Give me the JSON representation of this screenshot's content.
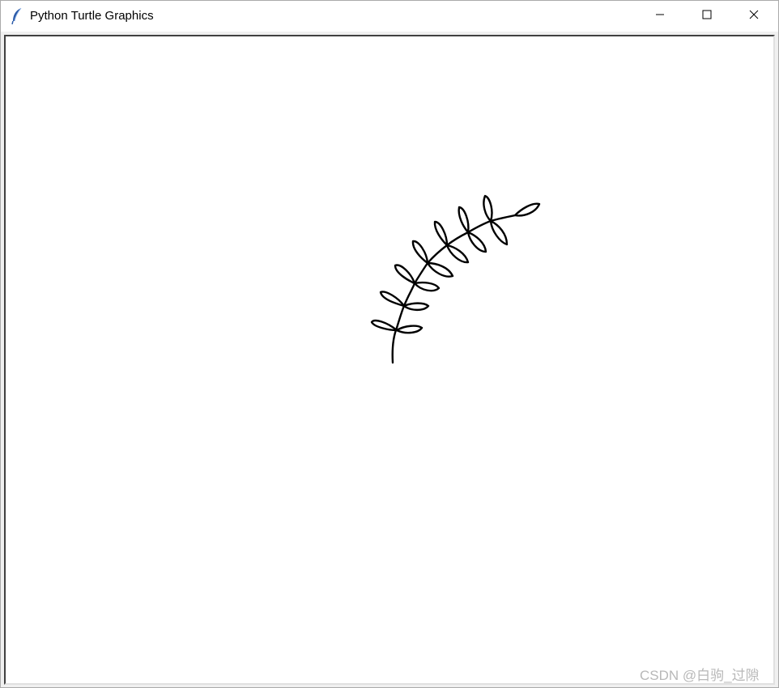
{
  "window": {
    "title": "Python Turtle Graphics",
    "app_icon": "feather-icon",
    "controls": {
      "minimize_icon": "minimize-icon",
      "maximize_icon": "maximize-icon",
      "close_icon": "close-icon"
    }
  },
  "canvas": {
    "background": "#ffffff",
    "stroke_color": "#000000",
    "drawing": "leafy-branch"
  },
  "watermark": {
    "text": "CSDN @白驹_过隙"
  }
}
